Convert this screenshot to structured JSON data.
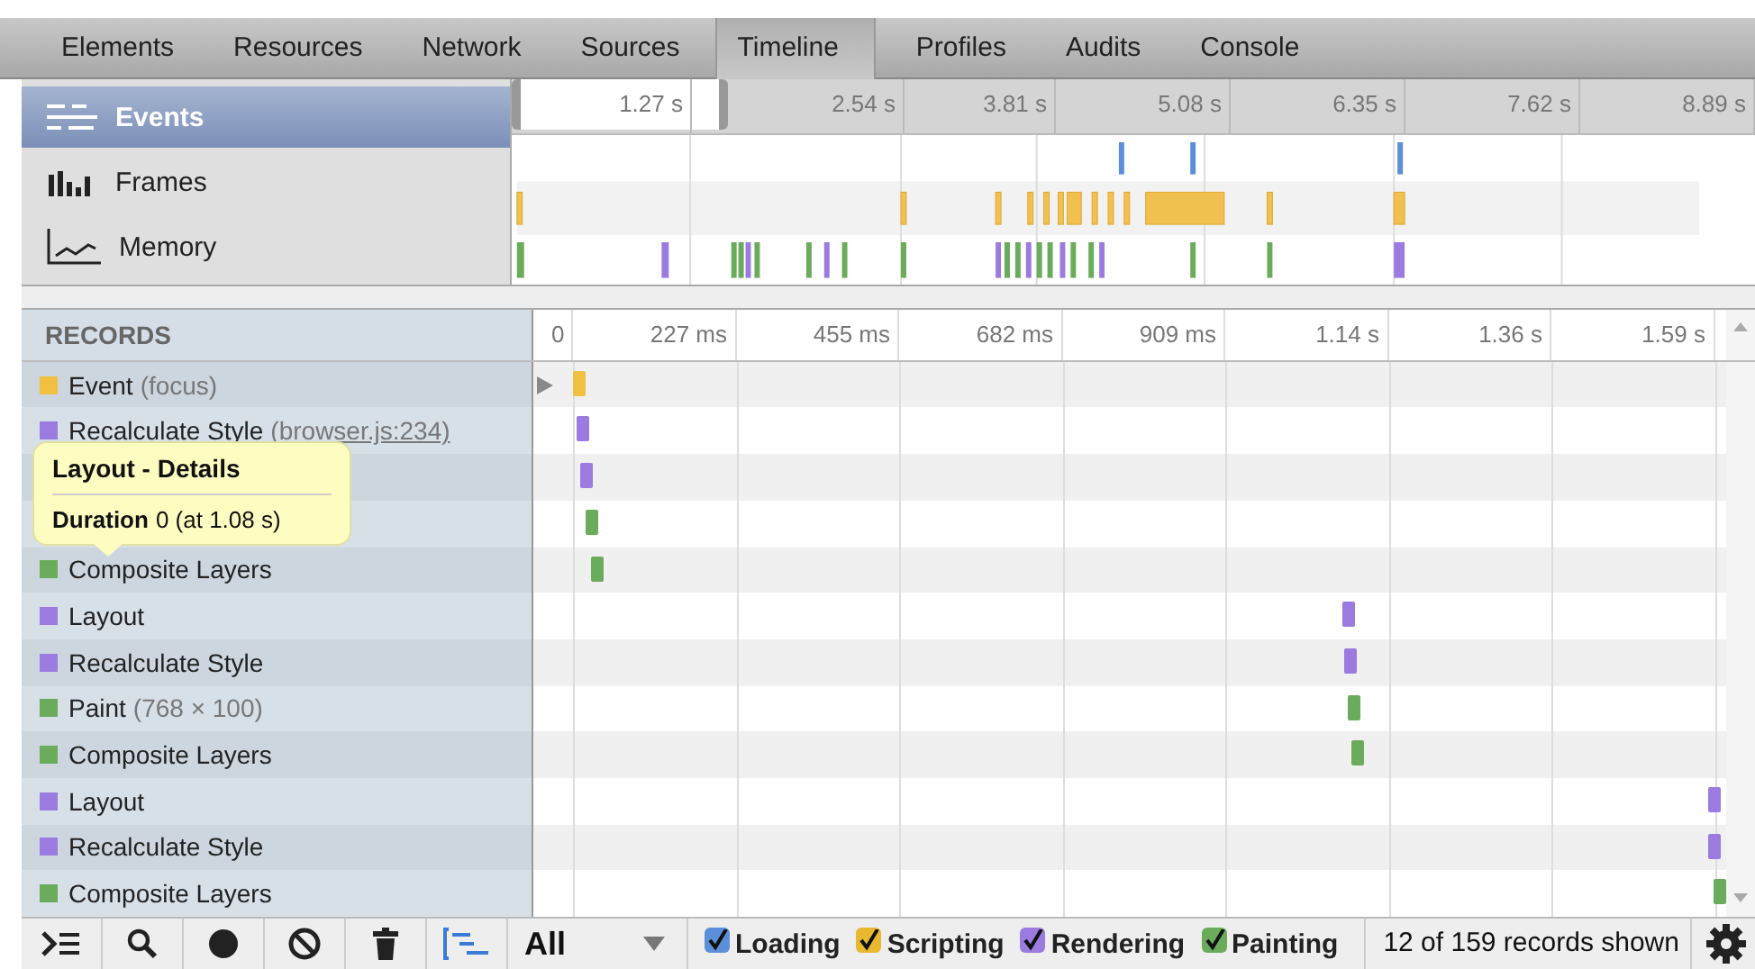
{
  "tabs": [
    {
      "label": "Elements",
      "selected": false
    },
    {
      "label": "Resources",
      "selected": false
    },
    {
      "label": "Network",
      "selected": false
    },
    {
      "label": "Sources",
      "selected": false
    },
    {
      "label": "Timeline",
      "selected": true
    },
    {
      "label": "Profiles",
      "selected": false
    },
    {
      "label": "Audits",
      "selected": false
    },
    {
      "label": "Console",
      "selected": false
    }
  ],
  "overview": {
    "modes": [
      {
        "label": "Events",
        "kind": "events",
        "selected": true
      },
      {
        "label": "Frames",
        "kind": "frames",
        "selected": false
      },
      {
        "label": "Memory",
        "kind": "memory",
        "selected": false
      }
    ],
    "ruler": [
      "1.27 s",
      "2.54 s",
      "3.81 s",
      "5.08 s",
      "6.35 s",
      "7.62 s",
      "8.89 s"
    ]
  },
  "records": {
    "header": "RECORDS",
    "ruler": [
      "0",
      "227 ms",
      "455 ms",
      "682 ms",
      "909 ms",
      "1.14 s",
      "1.36 s",
      "1.59 s"
    ],
    "rows": [
      {
        "name": "Event",
        "detail": "(focus)",
        "detail_link": false,
        "color": "#f0c040",
        "expanded": false
      },
      {
        "name": "Recalculate Style",
        "detail": "(browser.js:234)",
        "detail_link": true,
        "color": "#9b7be0"
      },
      {
        "color": "#9b7be0"
      },
      {
        "color": "#6aac5b"
      },
      {
        "name": "Composite Layers",
        "color": "#6aac5b"
      },
      {
        "name": "Layout",
        "color": "#9b7be0"
      },
      {
        "name": "Recalculate Style",
        "color": "#9b7be0"
      },
      {
        "name": "Paint",
        "detail": "(768 × 100)",
        "detail_link": false,
        "color": "#6aac5b"
      },
      {
        "name": "Composite Layers",
        "color": "#6aac5b"
      },
      {
        "name": "Layout",
        "color": "#9b7be0"
      },
      {
        "name": "Recalculate Style",
        "color": "#9b7be0"
      },
      {
        "name": "Composite Layers",
        "color": "#6aac5b"
      }
    ]
  },
  "tooltip": {
    "title": "Layout - Details",
    "label": "Duration",
    "value": "0 (at 1.08 s)"
  },
  "status_bar": {
    "tools": [
      {
        "kind": "dock"
      },
      {
        "kind": "search"
      },
      {
        "kind": "record"
      },
      {
        "kind": "clear"
      },
      {
        "kind": "trash"
      },
      {
        "kind": "tree",
        "selected": true
      }
    ],
    "filter": "All",
    "categories": [
      {
        "label": "Loading",
        "checked": true,
        "color": "#5b8fd9"
      },
      {
        "label": "Scripting",
        "checked": true,
        "color": "#e8b830"
      },
      {
        "label": "Rendering",
        "checked": true,
        "color": "#9b7be0"
      },
      {
        "label": "Painting",
        "checked": true,
        "color": "#6aac5b"
      }
    ],
    "count": "12 of 159 records shown"
  }
}
